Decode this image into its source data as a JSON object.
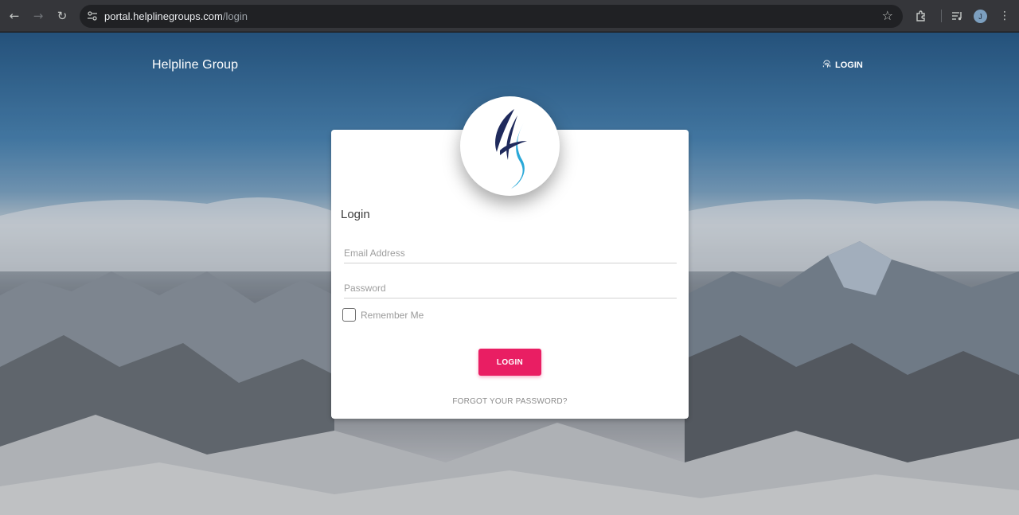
{
  "browser": {
    "url_host": "portal.helplinegroups.com",
    "url_path": "/login",
    "avatar_letter": "J",
    "icons": [
      "back-arrow-icon",
      "forward-arrow-icon",
      "reload-icon",
      "site-settings-icon",
      "star-icon",
      "extensions-icon",
      "media-controls-icon",
      "profile-avatar",
      "more-menu-icon"
    ]
  },
  "header": {
    "brand": "Helpline Group",
    "login_label": "LOGIN",
    "login_icon": "fingerprint-icon"
  },
  "form": {
    "title": "Login",
    "email_placeholder": "Email Address",
    "email_value": "",
    "password_placeholder": "Password",
    "password_value": "",
    "remember_label": "Remember Me",
    "remember_checked": false,
    "submit_label": "LOGIN",
    "forgot_label": "FORGOT YOUR PASSWORD?"
  },
  "colors": {
    "accent": "#e91e63",
    "logo_dark": "#1f2a5c",
    "logo_light": "#29a8d8"
  }
}
